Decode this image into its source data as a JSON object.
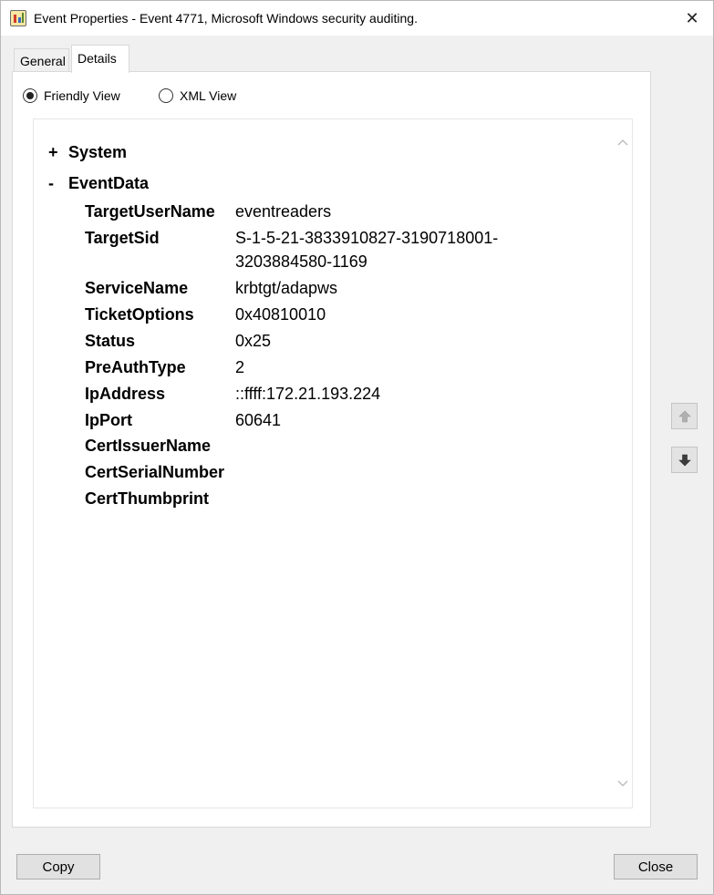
{
  "window": {
    "title": "Event Properties - Event 4771, Microsoft Windows security auditing.",
    "close_glyph": "✕"
  },
  "tabs": [
    {
      "label": "General",
      "active": false
    },
    {
      "label": "Details",
      "active": true
    }
  ],
  "view_options": {
    "friendly": {
      "label": "Friendly View",
      "selected": true
    },
    "xml": {
      "label": "XML View",
      "selected": false
    }
  },
  "tree": {
    "system": {
      "toggle": "+",
      "label": "System"
    },
    "eventdata": {
      "toggle": "-",
      "label": "EventData"
    },
    "fields": [
      {
        "name": "TargetUserName",
        "value": "eventreaders"
      },
      {
        "name": "TargetSid",
        "value": "S-1-5-21-3833910827-3190718001-",
        "value2": "3203884580-1169"
      },
      {
        "name": "ServiceName",
        "value": "krbtgt/adapws"
      },
      {
        "name": "TicketOptions",
        "value": "0x40810010"
      },
      {
        "name": "Status",
        "value": "0x25"
      },
      {
        "name": "PreAuthType",
        "value": "2"
      },
      {
        "name": "IpAddress",
        "value": "::ffff:172.21.193.224"
      },
      {
        "name": "IpPort",
        "value": "60641"
      },
      {
        "name": "CertIssuerName",
        "value": ""
      },
      {
        "name": "CertSerialNumber",
        "value": ""
      },
      {
        "name": "CertThumbprint",
        "value": ""
      }
    ]
  },
  "scrollbar": {
    "up_glyph": "︿",
    "down_glyph": "﹀"
  },
  "buttons": {
    "copy": "Copy",
    "close": "Close"
  },
  "icons": {
    "app": "event-viewer-icon",
    "close": "close-icon",
    "side_up": "arrow-up-icon",
    "side_down": "arrow-down-icon"
  }
}
